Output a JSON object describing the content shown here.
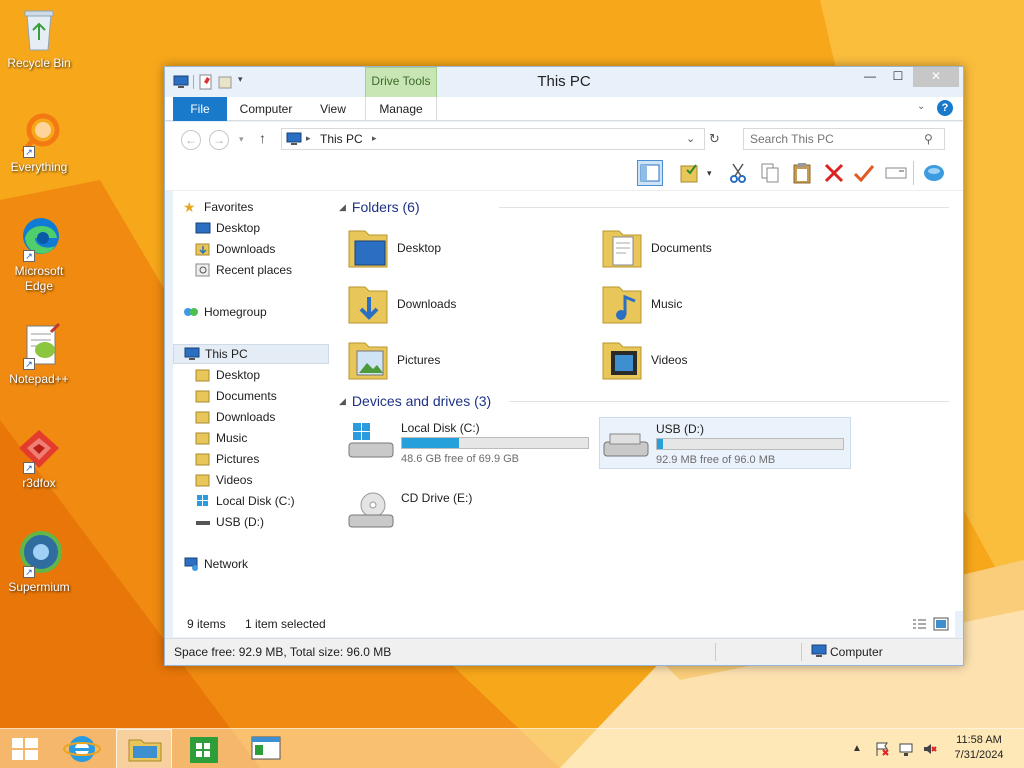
{
  "desktop": {
    "icons": [
      {
        "label": "Recycle Bin"
      },
      {
        "label": "Everything"
      },
      {
        "label": "Microsoft Edge"
      },
      {
        "label": "Notepad++"
      },
      {
        "label": "r3dfox"
      },
      {
        "label": "Supermium"
      }
    ]
  },
  "window": {
    "title": "This PC",
    "contextual_tab": "Drive Tools",
    "ribbon_tabs": {
      "file": "File",
      "computer": "Computer",
      "view": "View",
      "manage": "Manage"
    },
    "address": {
      "location": "This PC"
    },
    "search": {
      "placeholder": "Search This PC"
    }
  },
  "nav_pane": {
    "favorites": {
      "label": "Favorites",
      "items": [
        "Desktop",
        "Downloads",
        "Recent places"
      ]
    },
    "homegroup": "Homegroup",
    "this_pc": {
      "label": "This PC",
      "items": [
        "Desktop",
        "Documents",
        "Downloads",
        "Music",
        "Pictures",
        "Videos",
        "Local Disk (C:)",
        "USB (D:)"
      ]
    },
    "network": "Network"
  },
  "content": {
    "folders_header": "Folders (6)",
    "folders": [
      "Desktop",
      "Documents",
      "Downloads",
      "Music",
      "Pictures",
      "Videos"
    ],
    "devices_header": "Devices and drives (3)",
    "drives": [
      {
        "name": "Local Disk (C:)",
        "free_text": "48.6 GB free of 69.9 GB",
        "used_fraction": 0.305
      },
      {
        "name": "USB (D:)",
        "free_text": "92.9 MB free of 96.0 MB",
        "used_fraction": 0.032
      },
      {
        "name": "CD Drive (E:)"
      }
    ]
  },
  "status": {
    "item_count": "9 items",
    "selection": "1 item selected",
    "space_info": "Space free: 92.9 MB, Total size: 96.0 MB",
    "location_label": "Computer"
  },
  "taskbar": {
    "clock_time": "11:58 AM",
    "clock_date": "7/31/2024"
  },
  "colors": {
    "accent": "#1979ca",
    "drive_fill": "#26a0da",
    "drive_tools": "#c8e6b4",
    "wallpaper": "#f5a316"
  }
}
